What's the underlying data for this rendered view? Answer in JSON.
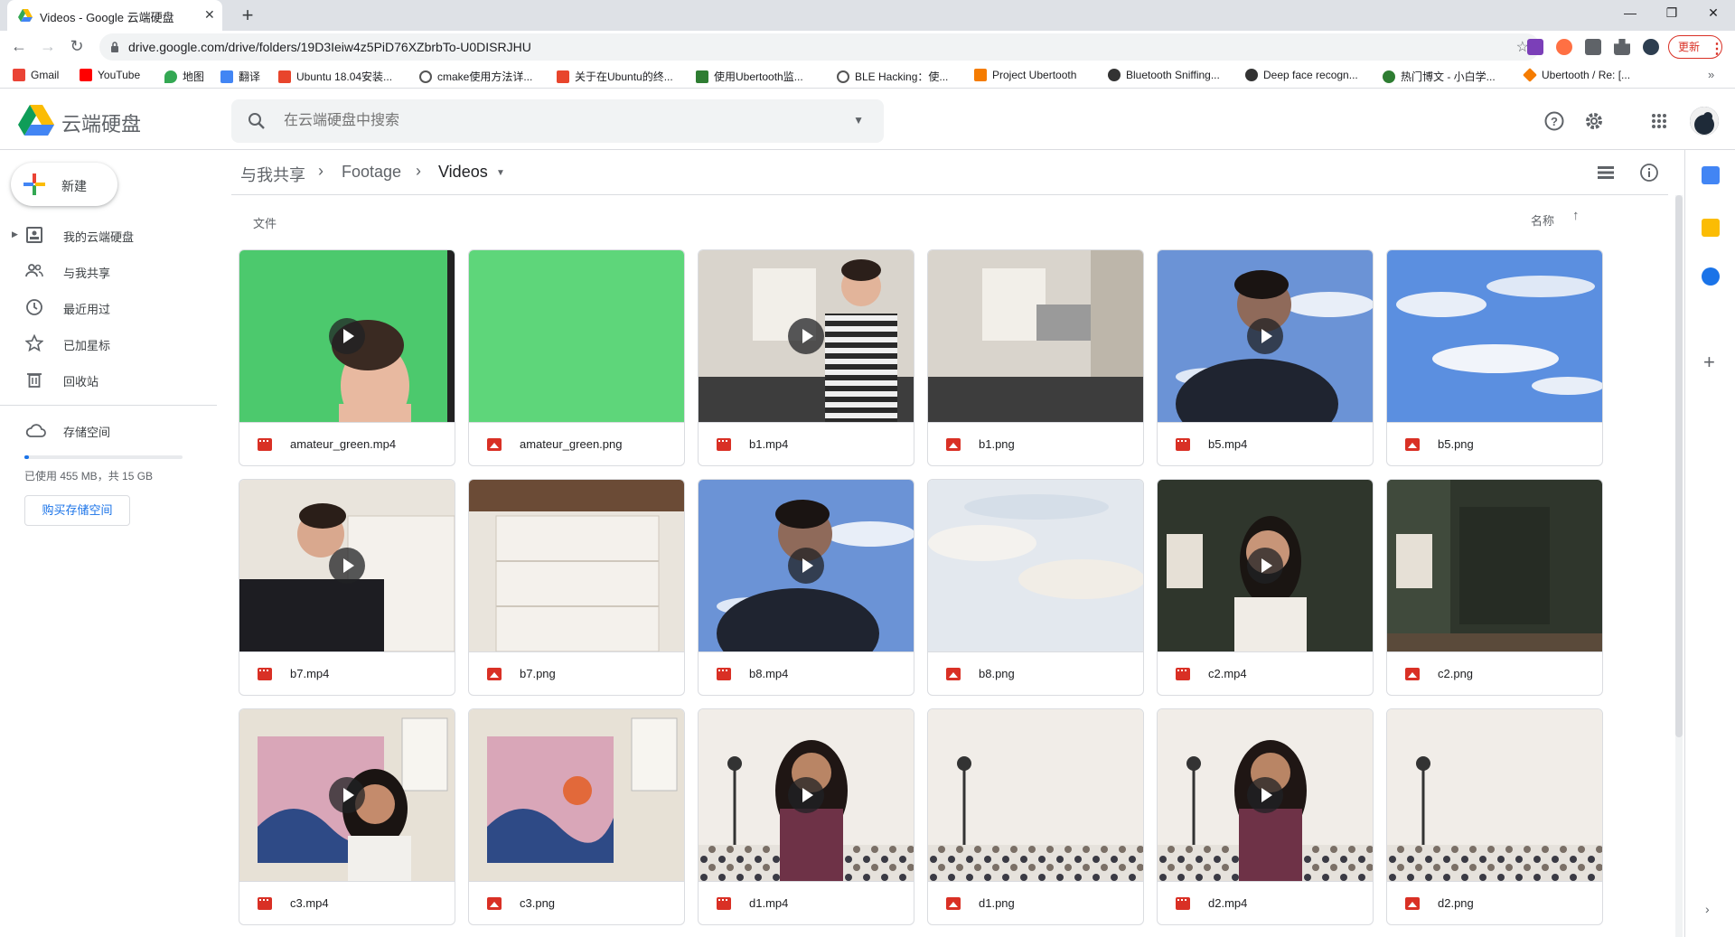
{
  "browser": {
    "tab_title": "Videos - Google 云端硬盘",
    "url": "drive.google.com/drive/folders/19D3Ieiw4z5PiD76XZbrbTo-U0DISRJHU",
    "update_label": "更新",
    "bookmarks": [
      {
        "label": "Gmail",
        "color": "#ea4335"
      },
      {
        "label": "YouTube",
        "color": "#ff0000"
      },
      {
        "label": "地图",
        "color": "#34a853"
      },
      {
        "label": "翻译",
        "color": "#4285f4"
      },
      {
        "label": "Ubuntu 18.04安装...",
        "color": "#e8452c"
      },
      {
        "label": "cmake使用方法详...",
        "color": "#555555"
      },
      {
        "label": "关于在Ubuntu的终...",
        "color": "#e8452c"
      },
      {
        "label": "使用Ubertooth监...",
        "color": "#2e7d32"
      },
      {
        "label": "BLE Hacking：使...",
        "color": "#555555"
      },
      {
        "label": "Project Ubertooth",
        "color": "#f57c00"
      },
      {
        "label": "Bluetooth Sniffing...",
        "color": "#333333"
      },
      {
        "label": "Deep face recogn...",
        "color": "#333333"
      },
      {
        "label": "热门博文 - 小白学...",
        "color": "#2e7d32"
      },
      {
        "label": "Ubertooth / Re: [...",
        "color": "#f57c00"
      }
    ]
  },
  "header": {
    "app_name": "云端硬盘",
    "search_placeholder": "在云端硬盘中搜索"
  },
  "sidebar": {
    "new_label": "新建",
    "items": [
      {
        "label": "我的云端硬盘",
        "icon": "my-drive-icon"
      },
      {
        "label": "与我共享",
        "icon": "shared-icon"
      },
      {
        "label": "最近用过",
        "icon": "recent-icon"
      },
      {
        "label": "已加星标",
        "icon": "star-icon"
      },
      {
        "label": "回收站",
        "icon": "trash-icon"
      }
    ],
    "storage_label": "存储空间",
    "quota_fraction": 0.03,
    "quota_text": "已使用 455 MB，共 15 GB",
    "buy_label": "购买存储空间"
  },
  "breadcrumb": [
    "与我共享",
    "Footage",
    "Videos"
  ],
  "section_label": "文件",
  "sort_label": "名称",
  "files": [
    {
      "name": "amateur_green.mp4",
      "type": "video",
      "scene": "green-person"
    },
    {
      "name": "amateur_green.png",
      "type": "image",
      "scene": "green"
    },
    {
      "name": "b1.mp4",
      "type": "video",
      "scene": "kitchen-person"
    },
    {
      "name": "b1.png",
      "type": "image",
      "scene": "kitchen"
    },
    {
      "name": "b5.mp4",
      "type": "video",
      "scene": "sky-person"
    },
    {
      "name": "b5.png",
      "type": "image",
      "scene": "sky"
    },
    {
      "name": "b7.mp4",
      "type": "video",
      "scene": "drawers-person"
    },
    {
      "name": "b7.png",
      "type": "image",
      "scene": "drawers"
    },
    {
      "name": "b8.mp4",
      "type": "video",
      "scene": "sky-person"
    },
    {
      "name": "b8.png",
      "type": "image",
      "scene": "pale-sky"
    },
    {
      "name": "c2.mp4",
      "type": "video",
      "scene": "poster-person"
    },
    {
      "name": "c2.png",
      "type": "image",
      "scene": "poster"
    },
    {
      "name": "c3.mp4",
      "type": "video",
      "scene": "tapestry-person"
    },
    {
      "name": "c3.png",
      "type": "image",
      "scene": "tapestry"
    },
    {
      "name": "d1.mp4",
      "type": "video",
      "scene": "lamp-person"
    },
    {
      "name": "d1.png",
      "type": "image",
      "scene": "lamp"
    },
    {
      "name": "d2.mp4",
      "type": "video",
      "scene": "lamp-person"
    },
    {
      "name": "d2.png",
      "type": "image",
      "scene": "lamp"
    }
  ],
  "colors": {
    "accent": "#1a73e8",
    "file_icon": "#d93025",
    "update": "#d93025"
  }
}
